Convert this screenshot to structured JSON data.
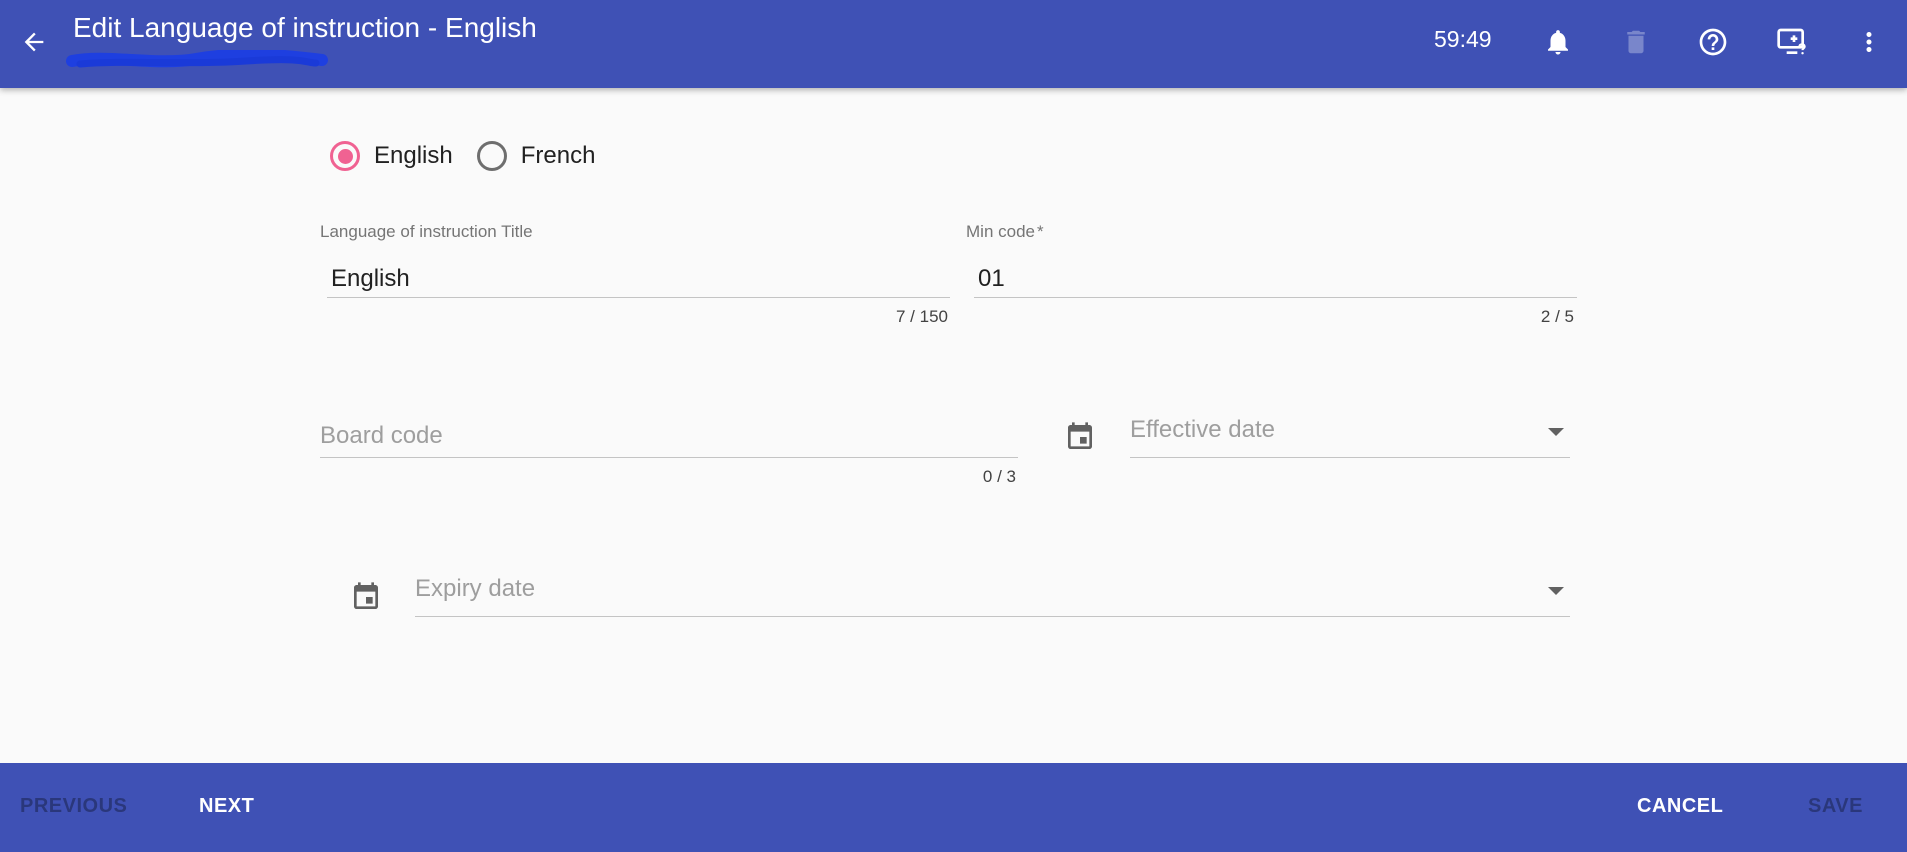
{
  "header": {
    "title": "Edit Language of instruction - English",
    "timer": "59:49",
    "icons": [
      "back-arrow-icon",
      "bell-icon",
      "trash-icon",
      "help-circle-icon",
      "screen-help-icon",
      "more-vert-icon"
    ]
  },
  "language_toggle": {
    "selected": "English",
    "options": [
      "English",
      "French"
    ]
  },
  "form": {
    "title_field": {
      "label": "Language of instruction Title",
      "value": "English",
      "counter": "7 / 150"
    },
    "min_code_field": {
      "label": "Min code",
      "required_mark": "*",
      "value": "01",
      "counter": "2 / 5"
    },
    "board_code_field": {
      "placeholder": "Board code",
      "value": "",
      "counter": "0 / 3"
    },
    "effective_date": {
      "placeholder": "Effective date"
    },
    "expiry_date": {
      "placeholder": "Expiry date"
    }
  },
  "footer": {
    "previous": "PREVIOUS",
    "next": "NEXT",
    "cancel": "CANCEL",
    "save": "SAVE"
  },
  "colors": {
    "primary": "#3f51b5",
    "accent": "#f06292",
    "background": "#fafafa"
  }
}
